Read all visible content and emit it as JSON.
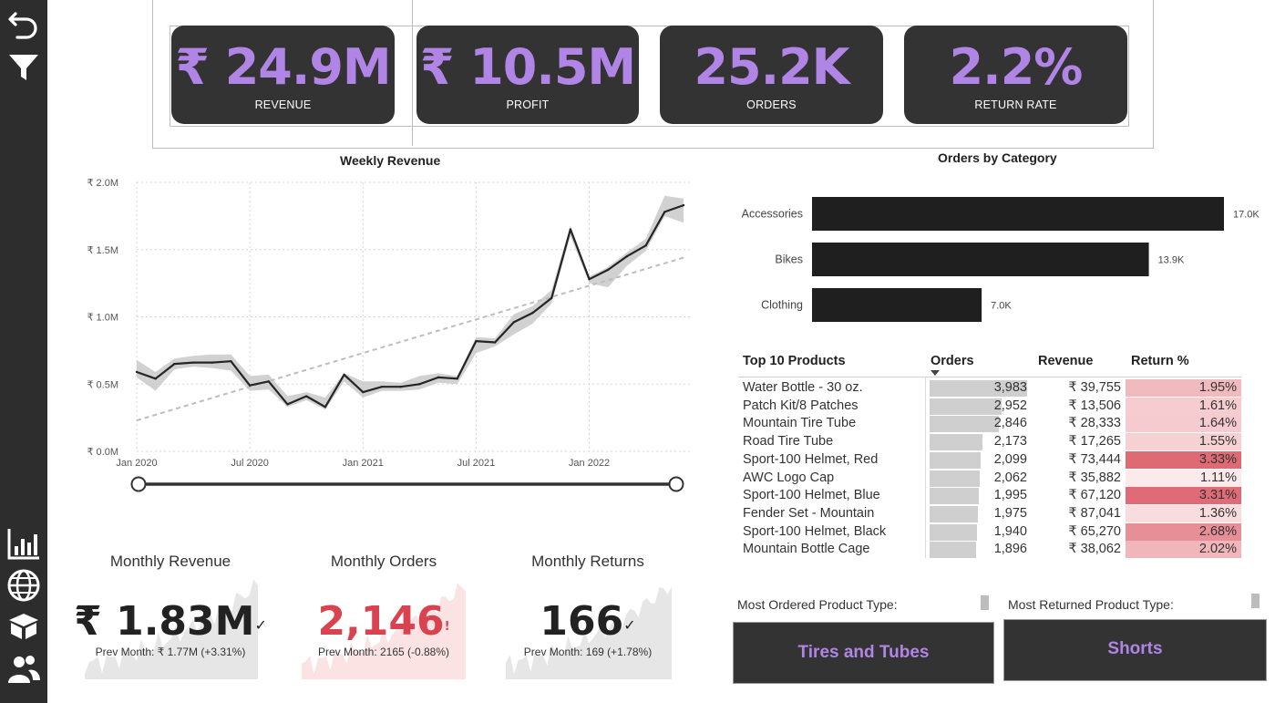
{
  "sidebar": {
    "top_icons": [
      "back-arrow-icon",
      "filter-icon"
    ],
    "bottom_icons": [
      "bar-chart-icon",
      "globe-icon",
      "box-icon",
      "users-icon"
    ]
  },
  "kpis": [
    {
      "value": "₹ 24.9M",
      "label": "REVENUE"
    },
    {
      "value": "₹ 10.5M",
      "label": "PROFIT"
    },
    {
      "value": "25.2K",
      "label": "ORDERS"
    },
    {
      "value": "2.2%",
      "label": "RETURN RATE"
    }
  ],
  "colors": {
    "accent": "#b085e6",
    "card": "#333333",
    "sidebar": "#2d2d2d",
    "alert": "#d9434f"
  },
  "weekly_revenue": {
    "title": "Weekly Revenue",
    "chart_data": {
      "type": "line",
      "title": "Weekly Revenue",
      "y_ticks": [
        "₹ 2.0M",
        "₹ 1.5M",
        "₹ 1.0M",
        "₹ 0.5M",
        "₹ 0.0M"
      ],
      "x_ticks": [
        "Jan 2020",
        "Jul 2020",
        "Jan 2021",
        "Jul 2021",
        "Jan 2022"
      ],
      "ylim": [
        0,
        2.0
      ],
      "x_months": [
        0,
        1,
        2,
        3,
        4,
        5,
        6,
        7,
        8,
        9,
        10,
        11,
        12,
        13,
        14,
        15,
        16,
        17,
        18,
        19,
        20,
        21,
        22,
        23,
        24,
        25,
        26,
        27,
        28,
        29
      ],
      "series": [
        {
          "values": [
            0.59,
            0.54,
            0.65,
            0.66,
            0.66,
            0.67,
            0.49,
            0.52,
            0.35,
            0.41,
            0.33,
            0.57,
            0.44,
            0.48,
            0.48,
            0.5,
            0.55,
            0.54,
            0.82,
            0.81,
            0.96,
            1.03,
            1.14,
            1.65,
            1.28,
            1.35,
            1.45,
            1.53,
            1.78,
            1.83
          ]
        }
      ],
      "band_upper": [
        0.68,
        0.59,
        0.69,
        0.71,
        0.72,
        0.72,
        0.56,
        0.57,
        0.41,
        0.44,
        0.4,
        0.58,
        0.52,
        0.52,
        0.51,
        0.56,
        0.58,
        0.56,
        0.85,
        0.84,
        1.02,
        1.08,
        1.2,
        1.68,
        1.3,
        1.37,
        1.48,
        1.58,
        1.9,
        1.88
      ],
      "band_lower": [
        0.55,
        0.45,
        0.61,
        0.63,
        0.62,
        0.6,
        0.45,
        0.46,
        0.33,
        0.38,
        0.31,
        0.52,
        0.4,
        0.45,
        0.45,
        0.46,
        0.51,
        0.5,
        0.73,
        0.78,
        0.87,
        0.95,
        1.1,
        1.6,
        1.25,
        1.22,
        1.38,
        1.49,
        1.75,
        1.7
      ],
      "trend": [
        0.23,
        1.44
      ],
      "grid": true
    }
  },
  "orders_by_category": {
    "title": "Orders by Category",
    "chart_data": {
      "type": "bar",
      "title": "Orders by Category",
      "categories": [
        "Accessories",
        "Bikes",
        "Clothing"
      ],
      "values": [
        17.0,
        13.9,
        7.0
      ],
      "value_labels": [
        "17.0K",
        "13.9K",
        "7.0K"
      ]
    }
  },
  "top_products": {
    "headers": {
      "name": "Top 10 Products",
      "orders": "Orders",
      "revenue": "Revenue",
      "return_pct": "Return %"
    },
    "rows": [
      {
        "name": "Water Bottle - 30 oz.",
        "orders": "3,983",
        "orders_num": 3983,
        "revenue": "₹ 39,755",
        "return_pct": "1.95%",
        "ret_num": 1.95
      },
      {
        "name": "Patch Kit/8 Patches",
        "orders": "2,952",
        "orders_num": 2952,
        "revenue": "₹ 13,506",
        "return_pct": "1.61%",
        "ret_num": 1.61
      },
      {
        "name": "Mountain Tire Tube",
        "orders": "2,846",
        "orders_num": 2846,
        "revenue": "₹ 28,333",
        "return_pct": "1.64%",
        "ret_num": 1.64
      },
      {
        "name": "Road Tire Tube",
        "orders": "2,173",
        "orders_num": 2173,
        "revenue": "₹ 17,265",
        "return_pct": "1.55%",
        "ret_num": 1.55
      },
      {
        "name": "Sport-100 Helmet, Red",
        "orders": "2,099",
        "orders_num": 2099,
        "revenue": "₹ 73,444",
        "return_pct": "3.33%",
        "ret_num": 3.33
      },
      {
        "name": "AWC Logo Cap",
        "orders": "2,062",
        "orders_num": 2062,
        "revenue": "₹ 35,882",
        "return_pct": "1.11%",
        "ret_num": 1.11
      },
      {
        "name": "Sport-100 Helmet, Blue",
        "orders": "1,995",
        "orders_num": 1995,
        "revenue": "₹ 67,120",
        "return_pct": "3.31%",
        "ret_num": 3.31
      },
      {
        "name": "Fender Set - Mountain",
        "orders": "1,975",
        "orders_num": 1975,
        "revenue": "₹ 87,041",
        "return_pct": "1.36%",
        "ret_num": 1.36
      },
      {
        "name": "Sport-100 Helmet, Black",
        "orders": "1,940",
        "orders_num": 1940,
        "revenue": "₹ 65,270",
        "return_pct": "2.68%",
        "ret_num": 2.68
      },
      {
        "name": "Mountain Bottle Cage",
        "orders": "1,896",
        "orders_num": 1896,
        "revenue": "₹ 38,062",
        "return_pct": "2.02%",
        "ret_num": 2.02
      }
    ]
  },
  "monthly": [
    {
      "title": "Monthly Revenue",
      "value": "₹ 1.83M",
      "status": "✓",
      "prev": "Prev Month: ₹ 1.77M (+3.31%)",
      "color": "#222222",
      "spark": "#e6e6e6"
    },
    {
      "title": "Monthly Orders",
      "value": "2,146",
      "status": "!",
      "prev": "Prev Month: 2165 (-0.88%)",
      "color": "#d9434f",
      "spark": "#fbe3e3"
    },
    {
      "title": "Monthly Returns",
      "value": "166",
      "status": "✓",
      "prev": "Prev Month: 169 (+1.78%)",
      "color": "#222222",
      "spark": "#e6e6e6"
    }
  ],
  "product_types": {
    "most_ordered_label": "Most Ordered Product Type:",
    "most_ordered_value": "Tires and Tubes",
    "most_returned_label": "Most Returned Product Type:",
    "most_returned_value": "Shorts"
  }
}
